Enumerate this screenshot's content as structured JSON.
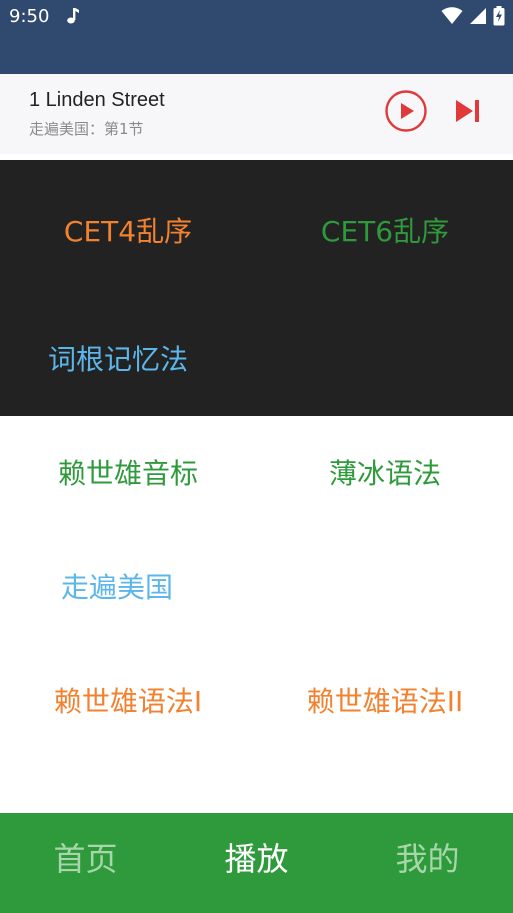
{
  "status_bar": {
    "time": "9:50",
    "icons": [
      "music-note-icon",
      "wifi-icon",
      "cell-signal-icon",
      "battery-charging-icon"
    ]
  },
  "now_playing": {
    "title": "1 Linden Street",
    "subtitle": "走遍美国：第1节",
    "controls": [
      "play-icon",
      "skip-next-icon"
    ]
  },
  "grid": {
    "dark": [
      {
        "label": "CET4乱序",
        "color": "#f2822f"
      },
      {
        "label": "CET6乱序",
        "color": "#2f9a3c"
      },
      {
        "label": "词根记忆法",
        "color": "#5cb6ea"
      }
    ],
    "light": [
      {
        "label": "赖世雄音标",
        "color": "#2f9a3c"
      },
      {
        "label": "薄冰语法",
        "color": "#2f9a3c"
      },
      {
        "label": "走遍美国",
        "color": "#5cb6ea"
      },
      {
        "label": "赖世雄语法I",
        "color": "#f2822f"
      },
      {
        "label": "赖世雄语法II",
        "color": "#f2822f"
      }
    ]
  },
  "bottom_nav": {
    "items": [
      {
        "label": "首页",
        "active": false
      },
      {
        "label": "播放",
        "active": true
      },
      {
        "label": "我的",
        "active": false
      }
    ]
  },
  "colors": {
    "app_bar": "#30496e",
    "accent_green": "#2f9a3c",
    "accent_orange": "#f2822f",
    "accent_blue": "#5cb6ea",
    "control_red": "#e0393a"
  }
}
